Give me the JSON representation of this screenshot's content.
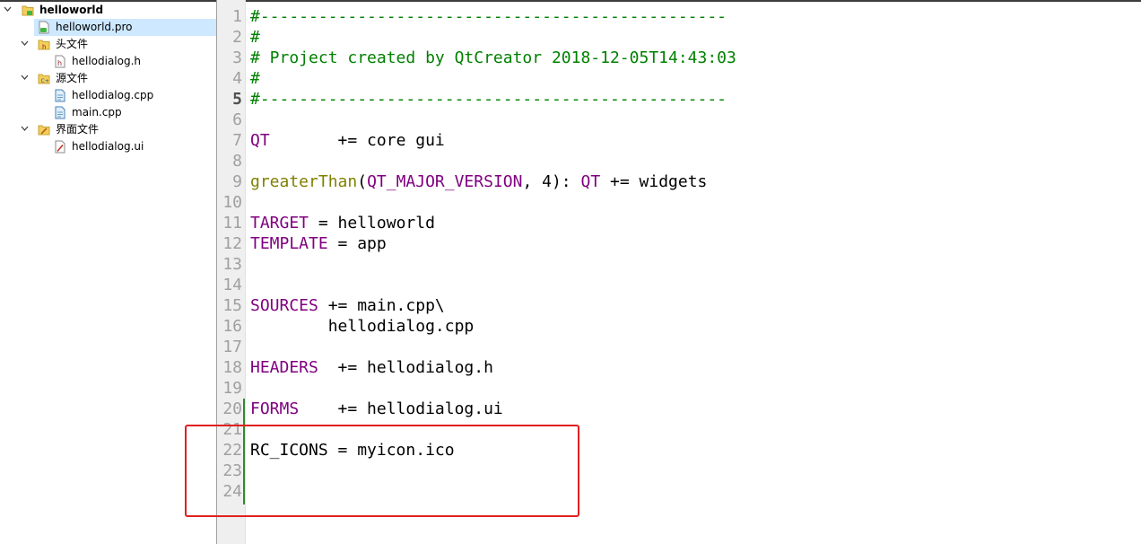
{
  "project_tree": {
    "root": {
      "label": "helloworld",
      "icon": "qt-project-folder-icon"
    },
    "pro_file": {
      "label": "helloworld.pro",
      "icon": "qt-pro-file-icon",
      "selected": true
    },
    "headers_group": {
      "label": "头文件",
      "icon": "header-folder-icon",
      "items": [
        {
          "label": "hellodialog.h",
          "icon": "header-file-icon"
        }
      ]
    },
    "sources_group": {
      "label": "源文件",
      "icon": "source-folder-icon",
      "items": [
        {
          "label": "hellodialog.cpp",
          "icon": "cpp-file-icon"
        },
        {
          "label": "main.cpp",
          "icon": "cpp-file-icon"
        }
      ]
    },
    "forms_group": {
      "label": "界面文件",
      "icon": "forms-folder-icon",
      "items": [
        {
          "label": "hellodialog.ui",
          "icon": "ui-form-file-icon"
        }
      ]
    }
  },
  "editor": {
    "current_line": "5",
    "line_numbers": [
      "1",
      "2",
      "3",
      "4",
      "5",
      "6",
      "7",
      "8",
      "9",
      "10",
      "11",
      "12",
      "13",
      "14",
      "15",
      "16",
      "17",
      "18",
      "19",
      "20",
      "21",
      "22",
      "23",
      "24"
    ],
    "lines": {
      "l1": "#------------------------------------------------",
      "l2": "#",
      "l3": "# Project created by QtCreator 2018-12-05T14:43:03",
      "l4": "#",
      "l5": "#------------------------------------------------",
      "l7_var": "QT",
      "l7_rest": "       += core gui",
      "l9_func": "greaterThan",
      "l9_p1": "(",
      "l9_var1": "QT_MAJOR_VERSION",
      "l9_p2": ", 4): ",
      "l9_var2": "QT",
      "l9_rest": " += widgets",
      "l11_var": "TARGET",
      "l11_rest": " = helloworld",
      "l12_var": "TEMPLATE",
      "l12_rest": " = app",
      "l15_var": "SOURCES",
      "l15_rest": " += main.cpp\\",
      "l16": "        hellodialog.cpp",
      "l18_var": "HEADERS",
      "l18_rest": "  += hellodialog.h",
      "l20_var": "FORMS",
      "l20_rest": "    += hellodialog.ui",
      "l22": "RC_ICONS = myicon.ico"
    }
  },
  "colors": {
    "comment": "#008000",
    "qmake_variable": "#800080",
    "qmake_function": "#808000",
    "selection": "#cde8ff",
    "annotation_box": "#e02020",
    "change_marker": "#2e8b2e"
  }
}
